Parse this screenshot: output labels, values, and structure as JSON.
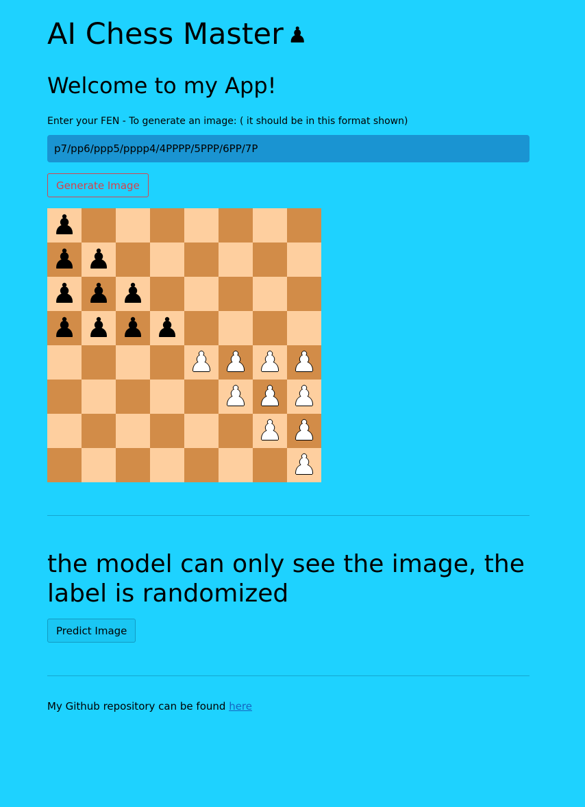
{
  "header": {
    "title": "AI Chess Master",
    "title_icon": "♟"
  },
  "welcome": "Welcome to my App!",
  "fen_section": {
    "label": "Enter your FEN - To generate an image: ( it should be in this format shown)",
    "input_value": "p7/pp6/ppp5/pppp4/4PPPP/5PPP/6PP/7P",
    "generate_button": "Generate Image"
  },
  "board": {
    "fen": "p7/pp6/ppp5/pppp4/4PPPP/5PPP/6PP/7P",
    "colors": {
      "light": "#fecf9f",
      "dark": "#d28c48"
    },
    "pieces": {
      "p": "♟",
      "P": "♙"
    }
  },
  "model_section": {
    "heading": "the model can only see the image, the label is randomized",
    "predict_button": "Predict Image"
  },
  "footer": {
    "text": "My Github repository can be found ",
    "link_text": "here"
  },
  "colors": {
    "background": "#1ed2ff",
    "input_bg": "#1a94d2",
    "generate_accent": "#d6404a",
    "link": "#1565c0"
  }
}
